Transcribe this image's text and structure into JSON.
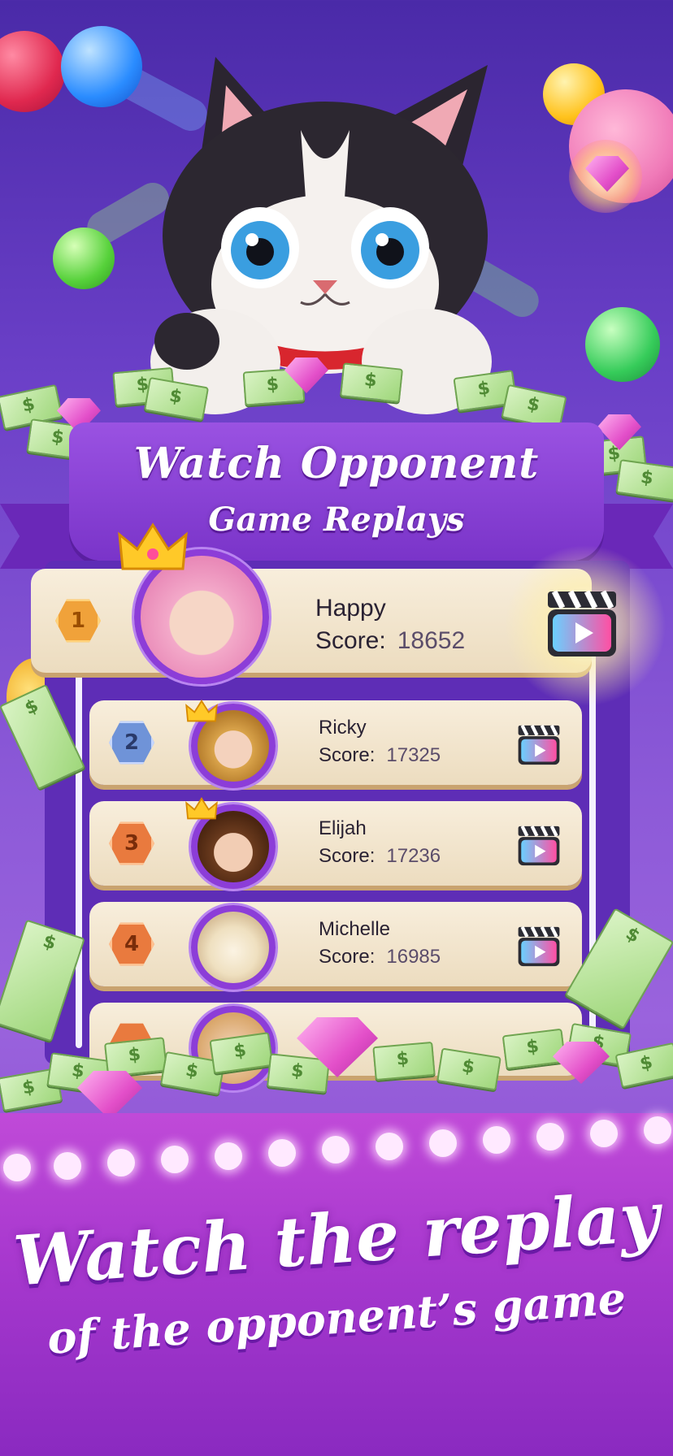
{
  "banner": {
    "title": "Watch Opponent",
    "subtitle": "Game Replays"
  },
  "leaderboard": [
    {
      "rank": "1",
      "name": "Happy",
      "score_label": "Score:",
      "score": "18652",
      "badge_color": "#f0a23a"
    },
    {
      "rank": "2",
      "name": "Ricky",
      "score_label": "Score:",
      "score": "17325",
      "badge_color": "#6f93d8"
    },
    {
      "rank": "3",
      "name": "Elijah",
      "score_label": "Score:",
      "score": "17236",
      "badge_color": "#e97a3e"
    },
    {
      "rank": "4",
      "name": "Michelle",
      "score_label": "Score:",
      "score": "16985",
      "badge_color": "#e97a3e"
    }
  ],
  "footer": {
    "line1": "Watch the replay",
    "line2": "of the opponent’s game"
  },
  "colors": {
    "accent": "#8c3dd8",
    "background": "#6a3fc7",
    "row": "#f4e7cf"
  }
}
